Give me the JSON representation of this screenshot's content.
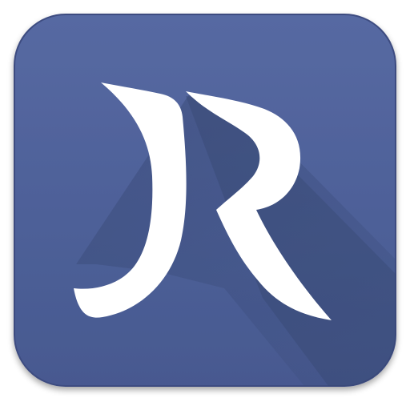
{
  "icon": {
    "name": "jr-app-icon",
    "logo_letters": "JR"
  },
  "colors": {
    "tile": "#4b5e98",
    "tile_highlight": "#5a6fa8",
    "tile_border": "#3c4c80",
    "long_shadow": "#3a4b7a",
    "glyph": "#ffffff"
  }
}
